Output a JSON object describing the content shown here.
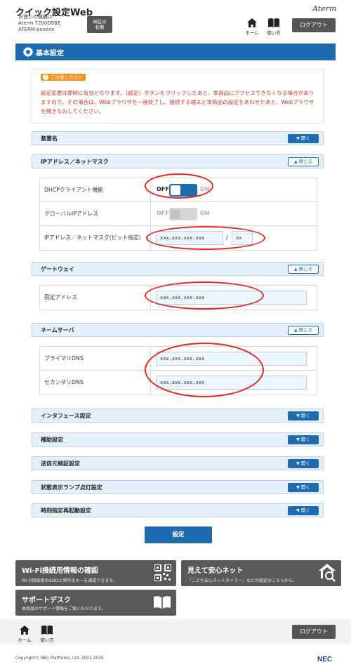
{
  "header": {
    "app_title": "クイック設定Web",
    "device_label": "お使いの機器は",
    "device_model": "Aterm 7200D8BE",
    "device_id": "ATERM-xxxxxx",
    "status_button_line1": "現在の",
    "status_button_line2": "状態",
    "home_label": "ホーム",
    "help_label": "使い方",
    "brand": "Aterm",
    "logout_label": "ログアウト"
  },
  "main": {
    "title": "基本設定",
    "notice": {
      "badge": "ご注意ください",
      "text": "設定変更は即時に有効となります。［設定］ボタンをクリックしたあと、本商品にアクセスできなくなる場合がありますので、その場合は、Webブラウザを一度終了し、接続する端末と本商品の設定をあわせたあと、Webブラウザを開きなおしてください。"
    },
    "open_label": "開く",
    "close_label": "閉じる",
    "sections": {
      "device_name": "装置名",
      "ip": "IPアドレス／ネットマスク",
      "gateway": "ゲートウェイ",
      "dns": "ネームサーバ",
      "interface": "インタフェース設定",
      "aux": "補助設定",
      "source_check": "送信元検証設定",
      "lamp": "状態表示ランプ点灯設定",
      "reboot": "時刻指定再起動設定"
    },
    "ip_rows": {
      "dhcp_label": "DHCPクライアント機能",
      "global_ip_label": "グローバルIPアドレス",
      "ip_mask_label": "IPアドレス／ネットマスク(ビット指定)",
      "ip_value": "xxx.xxx.xxx.xxx",
      "mask_sep": "/",
      "mask_value": "xx"
    },
    "toggle": {
      "off": "OFF",
      "on": "ON"
    },
    "gateway_rows": {
      "fixed_label": "固定アドレス",
      "fixed_value": "xxx.xxx.xxx.xxx"
    },
    "dns_rows": {
      "primary_label": "プライマリDNS",
      "primary_value": "xxx.xxx.xxx.xxx",
      "secondary_label": "セカンダリDNS",
      "secondary_value": "xxx.xxx.xxx.xxx"
    },
    "settings_button": "設定"
  },
  "tiles": {
    "wifi_title": "Wi-Fi接続用情報の確認",
    "wifi_sub": "Wi-Fi接続用のSSIDと暗号化キーを確認できます。",
    "safety_title": "見えて安心ネット",
    "safety_sub": "「こども安心ネットタイマー」などの設定はこちらから。",
    "support_title": "サポートデスク",
    "support_sub": "本商品のサポート情報をご覧いただけます。"
  },
  "footer": {
    "home_label": "ホーム",
    "help_label": "使い方",
    "logout_label": "ログアウト",
    "copyright": "Copyright© NEC Platforms, Ltd. 2001-2025",
    "brand": "NEC"
  },
  "colors": {
    "accent": "#1e6bb0",
    "highlight": "#e6261d",
    "notice": "#c0392b",
    "dark_button": "#555555"
  }
}
